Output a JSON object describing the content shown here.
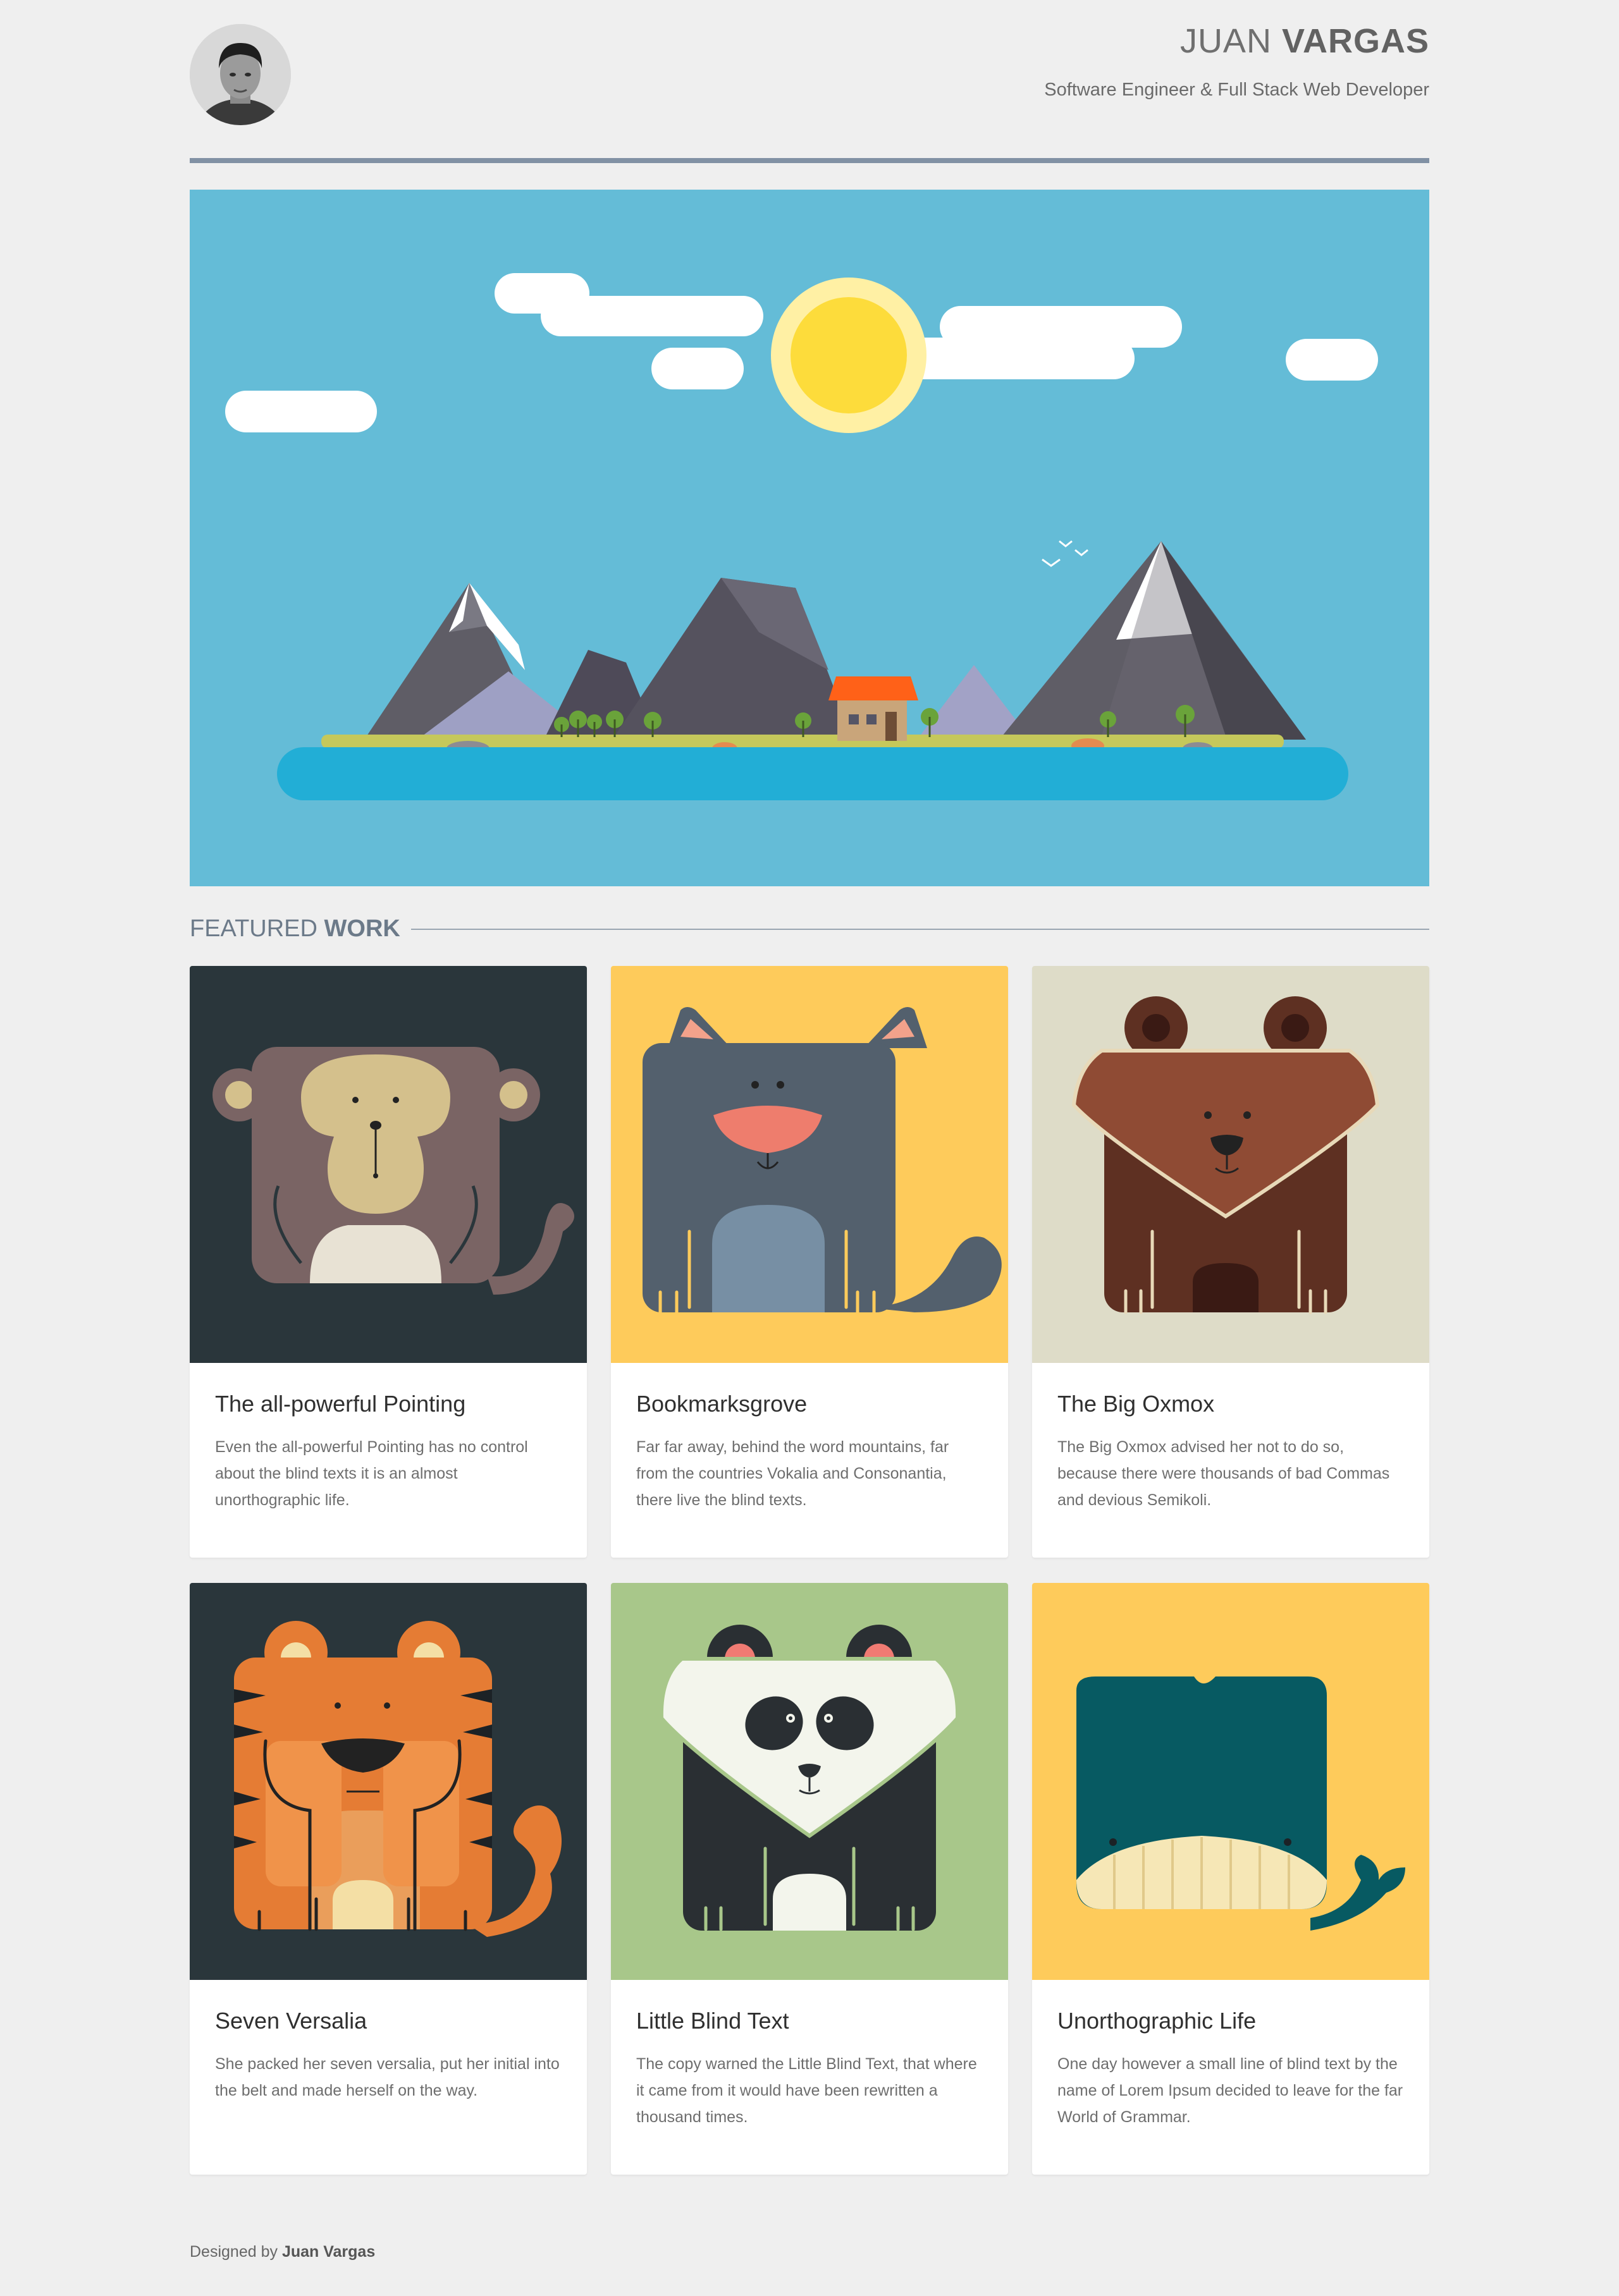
{
  "header": {
    "name_first": "JUAN",
    "name_last": "VARGAS",
    "tagline": "Software Engineer & Full Stack Web Developer"
  },
  "featured": {
    "title_light": "FEATURED",
    "title_bold": "WORK"
  },
  "cards": [
    {
      "title": "The all-powerful Pointing",
      "text": "Even the all-powerful Pointing has no control about the blind texts it is an almost unorthographic life.",
      "illustration": "monkey",
      "bg": "#2a363b"
    },
    {
      "title": "Bookmarksgrove",
      "text": "Far far away, behind the word mountains, far from the countries Vokalia and Consonantia, there live the blind texts.",
      "illustration": "cat",
      "bg": "#fecb5b"
    },
    {
      "title": "The Big Oxmox",
      "text": "The Big Oxmox advised her not to do so, because there were thousands of bad Commas and devious Semikoli.",
      "illustration": "bear",
      "bg": "#dedcc8"
    },
    {
      "title": "Seven Versalia",
      "text": "She packed her seven versalia, put her initial into the belt and made herself on the way.",
      "illustration": "tiger",
      "bg": "#2a363b"
    },
    {
      "title": "Little Blind Text",
      "text": "The copy warned the Little Blind Text, that where it came from it would have been rewritten a thousand times.",
      "illustration": "panda",
      "bg": "#a8c78a"
    },
    {
      "title": "Unorthographic Life",
      "text": "One day however a small line of blind text by the name of Lorem Ipsum decided to leave for the far World of Grammar.",
      "illustration": "whale",
      "bg": "#fecb5b"
    }
  ],
  "footer": {
    "prefix": "Designed by",
    "author": "Juan Vargas"
  },
  "colors": {
    "page_bg": "#efefef",
    "accent_rule": "#8191a4",
    "sky": "#64bcd7",
    "water": "#22aed6"
  }
}
